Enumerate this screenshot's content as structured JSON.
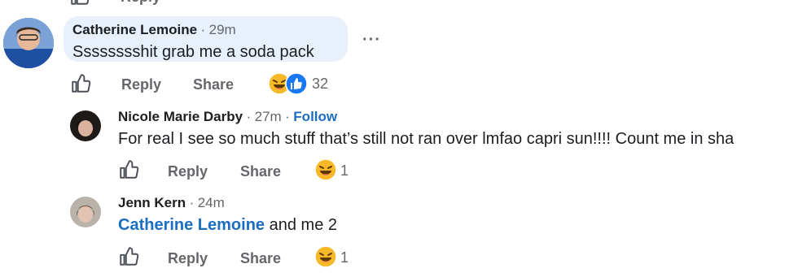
{
  "top_fragment": {
    "label": "Reply"
  },
  "comments": [
    {
      "author": "Catherine Lemoine",
      "separator": "·",
      "time": "29m",
      "text": "Sssssssshit grab me a soda pack",
      "actions": {
        "reply": "Reply",
        "share": "Share"
      },
      "reaction_count": "32",
      "reactions": [
        "haha-icon",
        "like-icon"
      ],
      "more": "···"
    },
    {
      "author": "Nicole Marie Darby",
      "separator": "·",
      "time": "27m",
      "follow": "Follow",
      "text": "For real I see so much stuff that’s still not ran over lmfao capri sun!!!! Count me in sha",
      "actions": {
        "reply": "Reply",
        "share": "Share"
      },
      "reaction_count": "1",
      "reactions": [
        "haha-icon"
      ]
    },
    {
      "author": "Jenn Kern",
      "separator": "·",
      "time": "24m",
      "mention": "Catherine Lemoine",
      "text": " and me 2",
      "actions": {
        "reply": "Reply",
        "share": "Share"
      },
      "reaction_count": "1",
      "reactions": [
        "haha-icon"
      ]
    }
  ],
  "colors": {
    "bubble": "#e7f0fb",
    "link": "#1b6ec2",
    "muted": "#65676b",
    "like_blue": "#1877f2",
    "haha_yellow": "#f7b928"
  }
}
